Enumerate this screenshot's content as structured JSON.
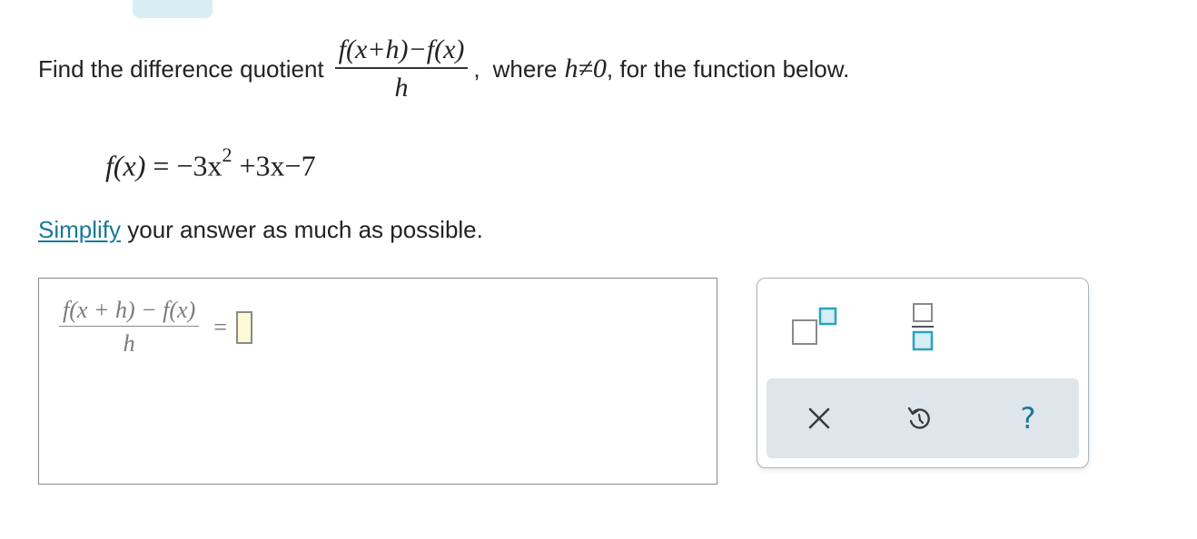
{
  "question": {
    "prefix": "Find the difference quotient",
    "quotient_numerator": "f(x+h)−f(x)",
    "quotient_denominator": "h",
    "suffix_comma": ",",
    "where_text": "where",
    "condition": "h≠0",
    "suffix_rest": ", for the function below."
  },
  "function": {
    "lhs": "f(x)",
    "equals": "=",
    "rhs_part1": "−3x",
    "exponent": "2",
    "rhs_part2": "+3x−7"
  },
  "instruction": {
    "link_text": "Simplify",
    "rest": " your answer as much as possible."
  },
  "answer": {
    "numerator": "f(x + h) − f(x)",
    "denominator": "h",
    "equals": "=",
    "value": ""
  },
  "palette": {
    "buttons": [
      {
        "name": "exponent-icon",
        "label": ""
      },
      {
        "name": "fraction-icon",
        "label": ""
      }
    ],
    "tray": [
      {
        "name": "clear-icon",
        "label": ""
      },
      {
        "name": "undo-icon",
        "label": ""
      },
      {
        "name": "help-icon",
        "label": "?"
      }
    ]
  },
  "colors": {
    "link": "#1a7a96",
    "accent_icon": "#2aa3bd",
    "answer_slot_fill": "#fff8d9",
    "tray_bg": "#dee6ec",
    "top_tab": "#d9eef3"
  }
}
